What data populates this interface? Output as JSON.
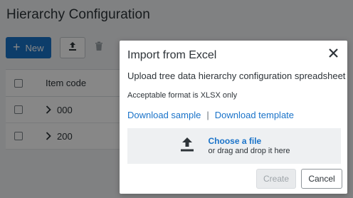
{
  "page": {
    "title": "Hierarchy Configuration",
    "toolbar": {
      "new_label": "New",
      "new_icon": "plus-icon",
      "upload_icon": "upload-icon",
      "delete_icon": "trash-icon"
    },
    "table": {
      "columns": [
        "Item code"
      ],
      "rows": [
        {
          "code": "000"
        },
        {
          "code": "200"
        }
      ]
    }
  },
  "modal": {
    "title": "Import from Excel",
    "subtitle": "Upload tree data hierarchy configuration spreadsheet",
    "format_note": "Acceptable format is XLSX only",
    "download_sample": "Download sample",
    "separator": "|",
    "download_template": "Download template",
    "dropzone": {
      "choose": "Choose a file",
      "drag": "or drag and drop it here",
      "icon": "upload-icon"
    },
    "create_label": "Create",
    "cancel_label": "Cancel",
    "close_icon": "close-icon"
  },
  "colors": {
    "accent": "#1a73c9",
    "overlay": "rgba(0,0,0,0.47)",
    "text": "#2d3338"
  }
}
